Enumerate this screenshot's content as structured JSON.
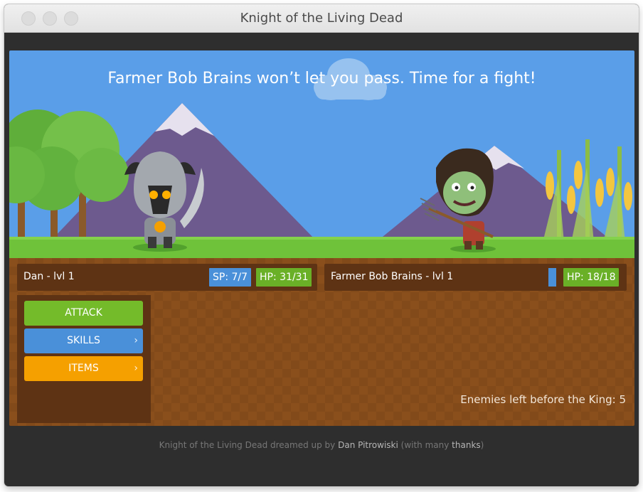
{
  "window": {
    "title": "Knight of the Living Dead"
  },
  "scene": {
    "headline": "Farmer Bob Brains won’t let you pass. Time for a fight!"
  },
  "player": {
    "name_level": "Dan - lvl 1",
    "sp": "SP: 7/7",
    "hp": "HP: 31/31"
  },
  "enemy": {
    "name_level": "Farmer Bob Brains - lvl 1",
    "sp_fraction": 1.0,
    "hp": "HP: 18/18"
  },
  "menu": {
    "attack": "ATTACK",
    "skills": "SKILLS",
    "items": "ITEMS",
    "chevron": "›"
  },
  "enemies_left": "Enemies left before the King: 5",
  "footer": {
    "prefix": "Knight of the Living Dead dreamed up by ",
    "author": "Dan Pitrowiski",
    "middle": " (with many ",
    "thanks": "thanks",
    "suffix": ")"
  },
  "colors": {
    "sky": "#5a9ee8",
    "grass": "#6fc23a",
    "attack": "#74bb2a",
    "skills": "#4a90d9",
    "items": "#f5a000"
  }
}
